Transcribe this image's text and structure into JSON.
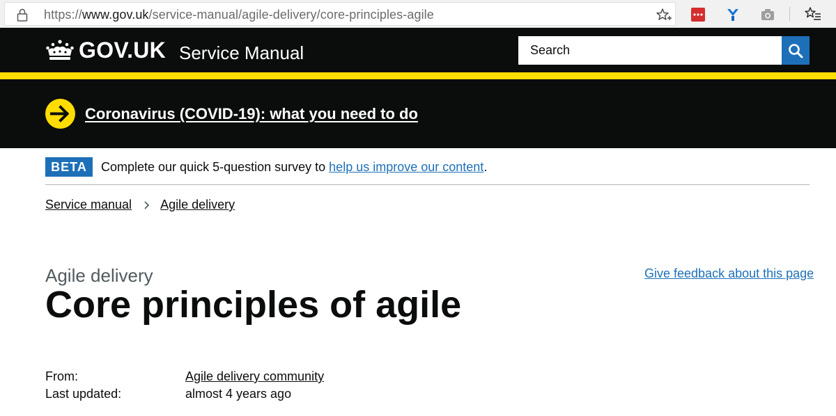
{
  "browser": {
    "url_prefix": "https://",
    "url_domain": "www.gov.uk",
    "url_path": "/service-manual/agile-delivery/core-principles-agile"
  },
  "header": {
    "logo_text": "GOV.UK",
    "service_name": "Service Manual",
    "search_placeholder": "Search"
  },
  "covid": {
    "link_text": "Coronavirus (COVID-19): what you need to do"
  },
  "beta": {
    "tag": "BETA",
    "text_before": "Complete our quick 5-question survey to ",
    "link_text": "help us improve our content",
    "text_after": "."
  },
  "breadcrumbs": [
    {
      "label": "Service manual"
    },
    {
      "label": "Agile delivery"
    }
  ],
  "page": {
    "caption": "Agile delivery",
    "title": "Core principles of agile",
    "feedback_link": "Give feedback about this page"
  },
  "metadata": {
    "from_label": "From:",
    "from_value": "Agile delivery community",
    "updated_label": "Last updated:",
    "updated_value": "almost 4 years ago"
  },
  "colors": {
    "black": "#0b0c0c",
    "yellow": "#ffdd00",
    "link_blue": "#1d70b8",
    "caption_grey": "#505a5f"
  },
  "icons": [
    "lock-icon",
    "star-icon",
    "extension-red-icon",
    "extension-blue-icon",
    "camera-icon",
    "favorites-icon",
    "crown-icon",
    "search-icon",
    "arrow-right-circle-icon",
    "chevron-right-icon"
  ]
}
